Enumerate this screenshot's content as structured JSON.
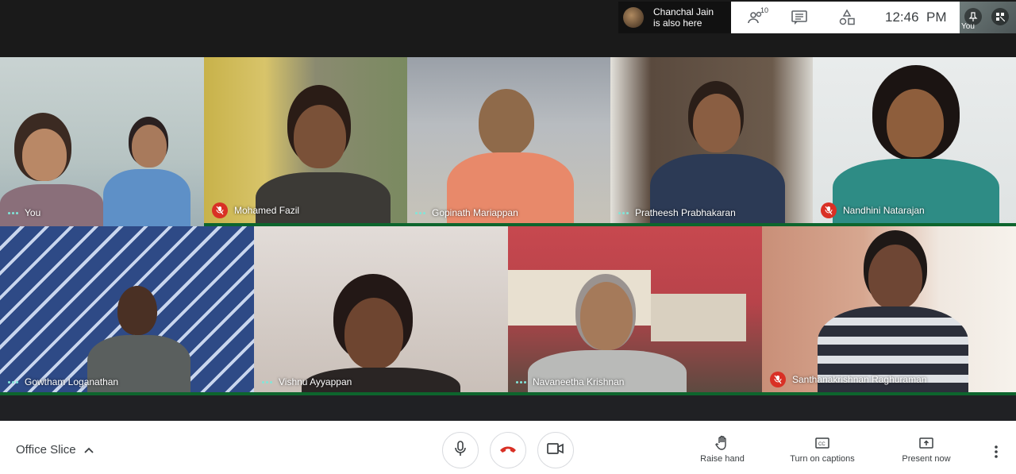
{
  "presence": {
    "name": "Chanchal Jain",
    "status": "is also here"
  },
  "infobar": {
    "participants_count": "10",
    "time": "12:46  PM"
  },
  "self_preview": {
    "label": "You"
  },
  "tiles": [
    {
      "name": "You",
      "muted": false
    },
    {
      "name": "Mohamed Fazil",
      "muted": true
    },
    {
      "name": "Gopinath Mariappan",
      "muted": false
    },
    {
      "name": "Pratheesh Prabhakaran",
      "muted": false
    },
    {
      "name": "Nandhini Natarajan",
      "muted": true
    },
    {
      "name": "Gowtham Loganathan",
      "muted": false
    },
    {
      "name": "Vishnu Ayyappan",
      "muted": false
    },
    {
      "name": "Navaneetha Krishnan",
      "muted": false
    },
    {
      "name": "Santhanakrishnan Raghuraman",
      "muted": true
    }
  ],
  "bottombar": {
    "meeting_name": "Office Slice",
    "raise_hand": "Raise hand",
    "captions": "Turn on captions",
    "present": "Present now"
  },
  "colors": {
    "accent_green": "#0d652d",
    "mute_red": "#d93025",
    "end_call_red": "#d93025"
  }
}
